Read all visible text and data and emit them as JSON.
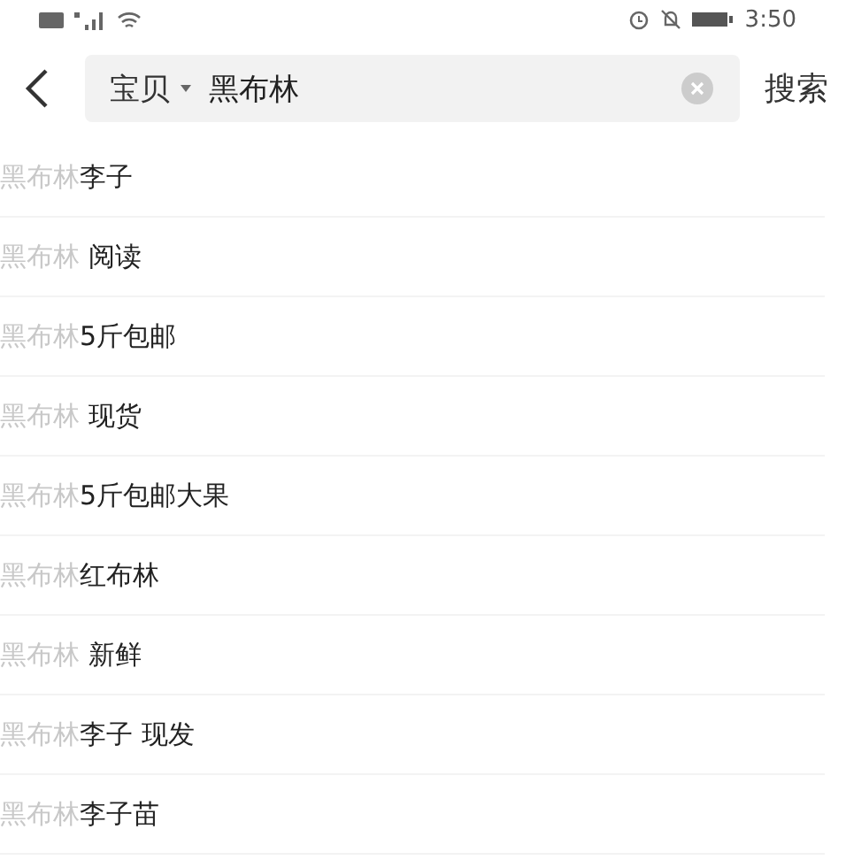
{
  "status_bar": {
    "time": "3:50"
  },
  "search": {
    "scope": "宝贝",
    "value": "黑布林",
    "action": "搜索"
  },
  "suggestions": [
    {
      "match": "黑布林",
      "rest": "李子"
    },
    {
      "match": "黑布林",
      "rest": " 阅读"
    },
    {
      "match": "黑布林",
      "rest": "5斤包邮"
    },
    {
      "match": "黑布林",
      "rest": " 现货"
    },
    {
      "match": "黑布林",
      "rest": "5斤包邮大果"
    },
    {
      "match": "黑布林",
      "rest": "红布林"
    },
    {
      "match": "黑布林",
      "rest": " 新鲜"
    },
    {
      "match": "黑布林",
      "rest": "李子 现发"
    },
    {
      "match": "黑布林",
      "rest": "李子苗"
    }
  ]
}
